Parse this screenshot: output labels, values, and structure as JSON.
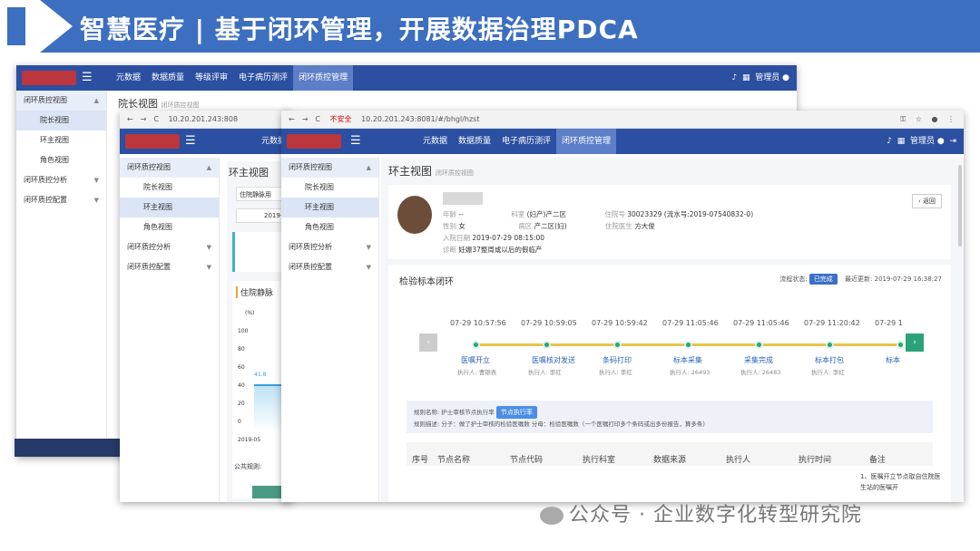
{
  "banner": {
    "title": "智慧医疗 | 基于闭环管理，开展数据治理PDCA"
  },
  "win1": {
    "menu": [
      "元数据",
      "数据质量",
      "等级评审",
      "电子病历测评",
      "闭环质控管理"
    ],
    "user": "管理员",
    "sidebar": [
      {
        "label": "闭环质控视图",
        "type": "parent"
      },
      {
        "label": "院长视图",
        "type": "sub-act"
      },
      {
        "label": "环主视图",
        "type": "sub"
      },
      {
        "label": "角色视图",
        "type": "sub"
      },
      {
        "label": "闭环质控分析",
        "type": "group"
      },
      {
        "label": "闭环质控配置",
        "type": "group"
      }
    ],
    "page_title": "院长视图",
    "page_sub": "闭环质控视图"
  },
  "win2": {
    "address": "10.20.201.243:808",
    "menu": [
      "元数据"
    ],
    "sidebar": [
      {
        "label": "闭环质控视图",
        "type": "parent"
      },
      {
        "label": "院长视图",
        "type": "sub"
      },
      {
        "label": "环主视图",
        "type": "sub-act"
      },
      {
        "label": "角色视图",
        "type": "sub"
      },
      {
        "label": "闭环质控分析",
        "type": "group"
      },
      {
        "label": "闭环质控配置",
        "type": "group"
      }
    ],
    "page_title": "环主视图",
    "filter": "住院静脉用",
    "date": "2019-",
    "chart_title": "住院静脉",
    "chart_unit": "(%)",
    "y_ticks": [
      "100",
      "80",
      "60",
      "40",
      "20",
      "0"
    ],
    "x_tick": "2019-05",
    "data_label": "41.8",
    "formula_label": "公共规则:"
  },
  "win3": {
    "insecure": "不安全",
    "address": "10.20.201.243:8081/#/bhgl/hzst",
    "menu": [
      "元数据",
      "数据质量",
      "电子病历测评",
      "闭环质控管理"
    ],
    "user": "管理员",
    "sidebar": [
      {
        "label": "闭环质控视图",
        "type": "parent"
      },
      {
        "label": "院长视图",
        "type": "sub"
      },
      {
        "label": "环主视图",
        "type": "sub-act"
      },
      {
        "label": "角色视图",
        "type": "sub"
      },
      {
        "label": "闭环质控分析",
        "type": "group"
      },
      {
        "label": "闭环质控配置",
        "type": "group"
      }
    ],
    "page_title": "环主视图",
    "page_sub": "闭环质控视图",
    "back": "‹ 返回",
    "patient": {
      "age_label": "年龄",
      "age": "--",
      "dept_label": "科室",
      "dept": "(妇产)产二区",
      "inpatient_label": "住院号",
      "inpatient": "30023329 (流水号:2019-07540832-0)",
      "sex_label": "性别",
      "sex": "女",
      "ward_label": "病区",
      "ward": "产二区(妇)",
      "doctor_label": "住院医生",
      "doctor": "方大俊",
      "admit_label": "入院日期",
      "admit": "2019-07-29 08:15:00",
      "diag_label": "诊断",
      "diag": "妊娠37整周或以后的假临产"
    },
    "loop_title": "检验标本闭环",
    "status_label": "流程状态:",
    "status": "已完成",
    "updated_label": "最近更新:",
    "updated": "2019-07-29 16:38:27",
    "timeline": [
      {
        "time": "07-29 10:57:56",
        "name": "医嘱开立",
        "exec": "执行人: 曹银表"
      },
      {
        "time": "07-29 10:59:05",
        "name": "医嘱核对发送",
        "exec": "执行人: 李红"
      },
      {
        "time": "07-29 10:59:42",
        "name": "条码打印",
        "exec": "执行人: 李红"
      },
      {
        "time": "07-29 11:05:46",
        "name": "标本采集",
        "exec": "执行人: 26493"
      },
      {
        "time": "07-29 11:05:46",
        "name": "采集完成",
        "exec": "执行人: 26483"
      },
      {
        "time": "07-29 11:20:42",
        "name": "标本打包",
        "exec": "执行人: 李红"
      },
      {
        "time": "07-29 1",
        "name": "标本",
        "exec": ""
      }
    ],
    "rule_name_label": "规则名称:",
    "rule_name": "护士审核节点执行率",
    "rule_tag": "节点执行率",
    "rule_desc_label": "规则描述:",
    "rule_desc": "分子：做了护士审核的检验医嘱数 分母：检验医嘱数（一个医嘱打印多个条码或出多份报告，算多条）",
    "table_headers": [
      "序号",
      "节点名称",
      "节点代码",
      "执行科室",
      "数据来源",
      "执行人",
      "执行时间",
      "备注"
    ],
    "note": "1、医嘱开立节点取自住院医生站的医嘱开"
  },
  "watermark": "公众号 · 企业数字化转型研究院",
  "colors": {
    "nav": "#2b4fa1",
    "banner": "#3d6fc0",
    "accent": "#2aa37a",
    "line": "#e8c34a"
  }
}
